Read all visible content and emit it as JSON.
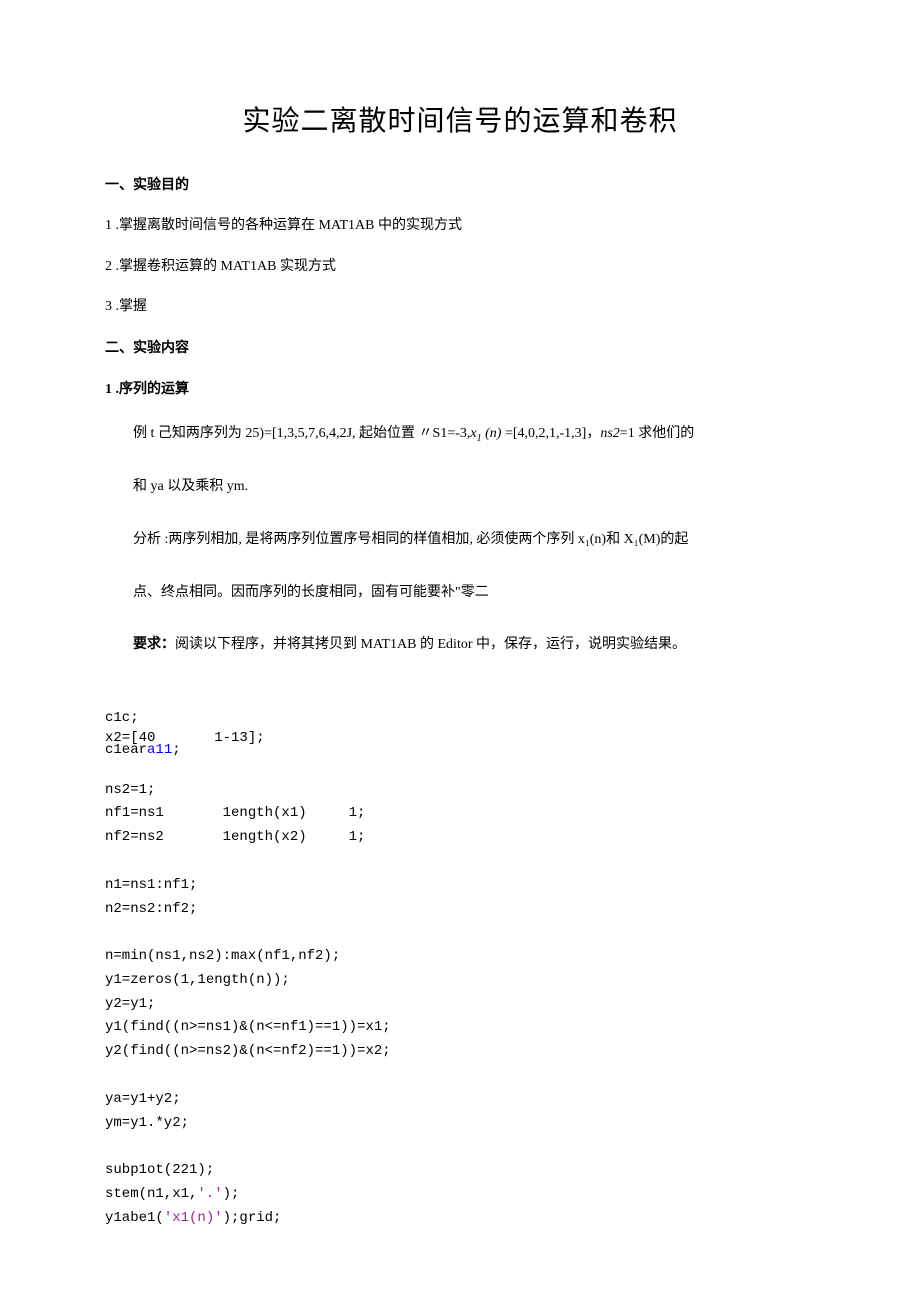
{
  "title": "实验二离散时间信号的运算和卷积",
  "sec1": {
    "heading": "一、实验目的",
    "items": [
      "1  .掌握离散时间信号的各种运算在 MAT1AB 中的实现方式",
      "2  .掌握卷积运算的 MAT1AB 实现方式",
      "3  .掌握"
    ]
  },
  "sec2": {
    "heading": "二、实验内容",
    "sub1": {
      "heading": "1  .序列的运算",
      "p1": {
        "prefix": "例 t 己知两序列为 25)=[1,3,5,7,6,4,2J, 起始位置 〃S1=-3,",
        "xi": "x",
        "xi_sub": "1",
        "xn": " (n) ",
        "eq": "=[4,0,2,1,-1,3]，",
        "ns2": "ns2",
        "ns2_tail": "=1 求他们的"
      },
      "p2": "和 ya 以及乘积 ym.",
      "p3": "分析 :两序列相加, 是将两序列位置序号相同的样值相加, 必须使两个序列 x₁(n)和 X₁(M)的起",
      "p4": "点、终点相同。因而序列的长度相同，固有可能要补\"零二",
      "p5": {
        "bold": "要求：",
        "tail": "阅读以下程序，并将其拷贝到 MAT1AB 的 Editor 中，保存，运行，说明实验结果。"
      }
    }
  },
  "code": {
    "l1": "c1c;",
    "overlap_a": "x2=[40       1-13];",
    "overlap_b_pre": "c1ear",
    "overlap_b_kw": "a11",
    "overlap_b_tail": ";",
    "l3": "ns2=1;",
    "l4": "nf1=ns1       1ength(x1)     1;",
    "l5": "nf2=ns2       1ength(x2)     1;",
    "l6": "n1=ns1:nf1;",
    "l7": "n2=ns2:nf2;",
    "l8": "n=min(ns1,ns2):max(nf1,nf2);",
    "l9": "y1=zeros(1,1ength(n));",
    "l10": "y2=y1;",
    "l11": "y1(find((n>=ns1)&(n<=nf1)==1))=x1;",
    "l12": "y2(find((n>=ns2)&(n<=nf2)==1))=x2;",
    "l13": "ya=y1+y2;",
    "l14": "ym=y1.*y2;",
    "l15": "subp1ot(221);",
    "l16_pre": "stem(n1,x1,",
    "l16_str": "'.'",
    "l16_tail": ");",
    "l17_pre": "y1abe1(",
    "l17_str": "'x1(n)'",
    "l17_tail": ");grid;"
  }
}
